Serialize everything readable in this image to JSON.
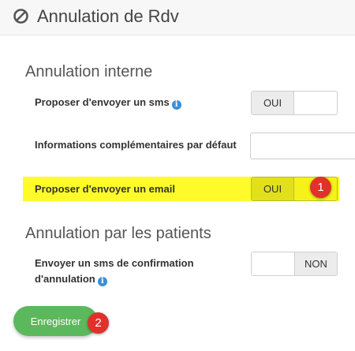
{
  "header": {
    "icon": "ban-icon",
    "title": "Annulation de Rdv"
  },
  "internal_section": {
    "title": "Annulation interne",
    "settings": [
      {
        "label": "Proposer d'envoyer un sms",
        "has_info_icon": true,
        "toggle": {
          "on_label": "OUI",
          "state": "on"
        }
      },
      {
        "label": "Informations complémentaires par défaut",
        "input_value": ""
      },
      {
        "label": "Proposer d'envoyer un email",
        "highlighted": true,
        "toggle": {
          "on_label": "OUI",
          "state": "on"
        }
      }
    ]
  },
  "patients_section": {
    "title": "Annulation par les patients",
    "settings": [
      {
        "label": "Envoyer un sms de confirmation d'annulation",
        "has_info_icon": true,
        "toggle": {
          "off_label": "NON",
          "state": "off"
        }
      }
    ]
  },
  "save_button": {
    "label": "Enregistrer"
  },
  "badges": [
    "1",
    "2"
  ],
  "colors": {
    "highlight": "#fffb2b",
    "badge": "#e0312b",
    "save_button": "#5cb85c",
    "info_icon": "#3a8fd9"
  }
}
